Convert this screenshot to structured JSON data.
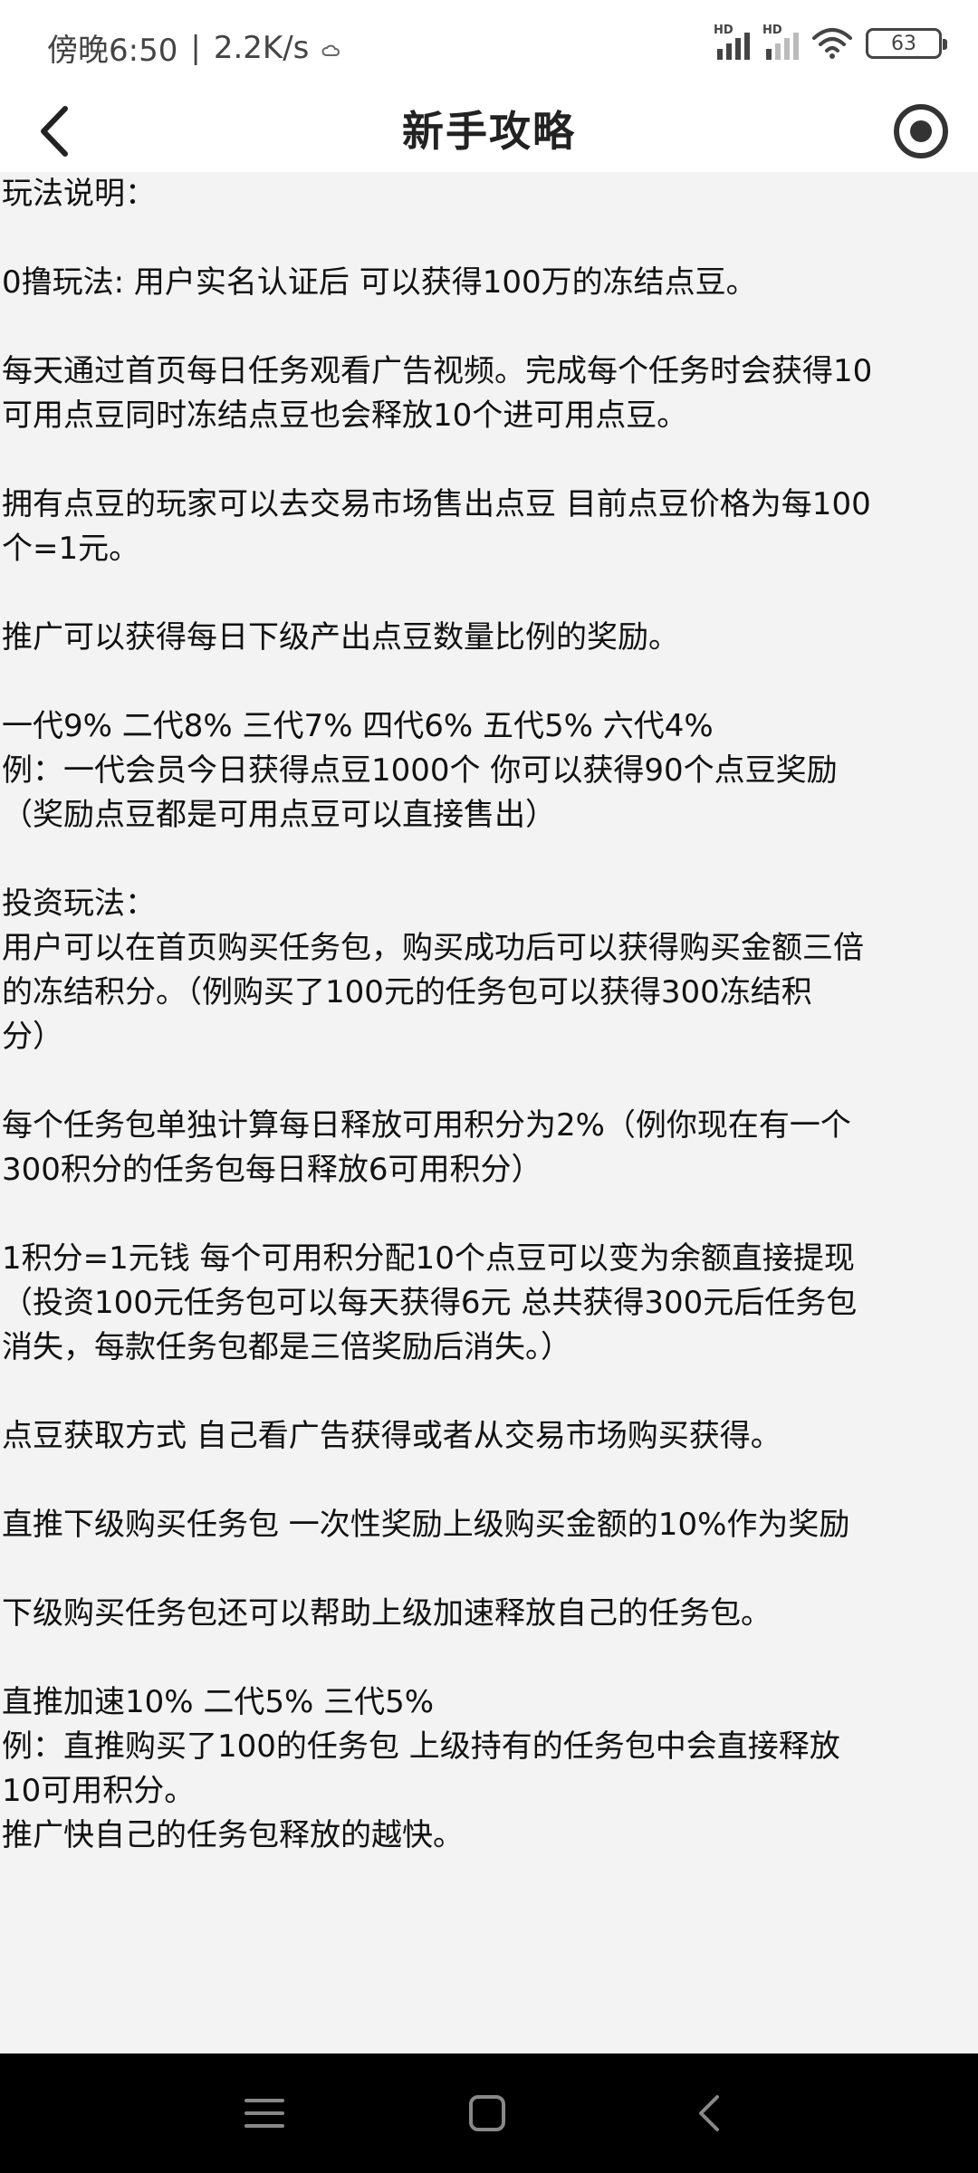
{
  "status_bar": {
    "time": "傍晚6:50",
    "network_speed": "2.2K/s",
    "separator": "|",
    "signal1_label": "HD",
    "signal2_label": "HD",
    "battery": "63"
  },
  "header": {
    "title": "新手攻略",
    "back_icon": "chevron-left-icon",
    "record_icon": "record-icon"
  },
  "content": {
    "lines": [
      "玩法说明：",
      "",
      "0撸玩法: 用户实名认证后 可以获得100万的冻结点豆。",
      "",
      "每天通过首页每日任务观看广告视频。完成每个任务时会获得10",
      "可用点豆同时冻结点豆也会释放10个进可用点豆。",
      "",
      "拥有点豆的玩家可以去交易市场售出点豆 目前点豆价格为每100",
      "个=1元。",
      "",
      "推广可以获得每日下级产出点豆数量比例的奖励。",
      "",
      "一代9% 二代8% 三代7% 四代6% 五代5% 六代4%",
      "例：一代会员今日获得点豆1000个 你可以获得90个点豆奖励",
      "（奖励点豆都是可用点豆可以直接售出）",
      "",
      "投资玩法：",
      "用户可以在首页购买任务包，购买成功后可以获得购买金额三倍",
      "的冻结积分。（例购买了100元的任务包可以获得300冻结积",
      "分）",
      "",
      "每个任务包单独计算每日释放可用积分为2%（例你现在有一个",
      "300积分的任务包每日释放6可用积分）",
      "",
      "1积分=1元钱   每个可用积分配10个点豆可以变为余额直接提现",
      "（投资100元任务包可以每天获得6元 总共获得300元后任务包",
      "消失，每款任务包都是三倍奖励后消失。）",
      "",
      "点豆获取方式 自己看广告获得或者从交易市场购买获得。",
      "",
      "直推下级购买任务包 一次性奖励上级购买金额的10%作为奖励",
      "",
      "下级购买任务包还可以帮助上级加速释放自己的任务包。",
      "",
      "直推加速10%   二代5%   三代5%",
      "例：直推购买了100的任务包   上级持有的任务包中会直接释放",
      "10可用积分。",
      "推广快自己的任务包释放的越快。"
    ]
  },
  "system_nav": {
    "menu_icon": "menu-icon",
    "home_icon": "home-icon",
    "back_icon": "back-triangle-icon"
  },
  "colors": {
    "content_bg": "#f3f3f3",
    "system_nav_bg": "#000000",
    "text": "#111111"
  }
}
